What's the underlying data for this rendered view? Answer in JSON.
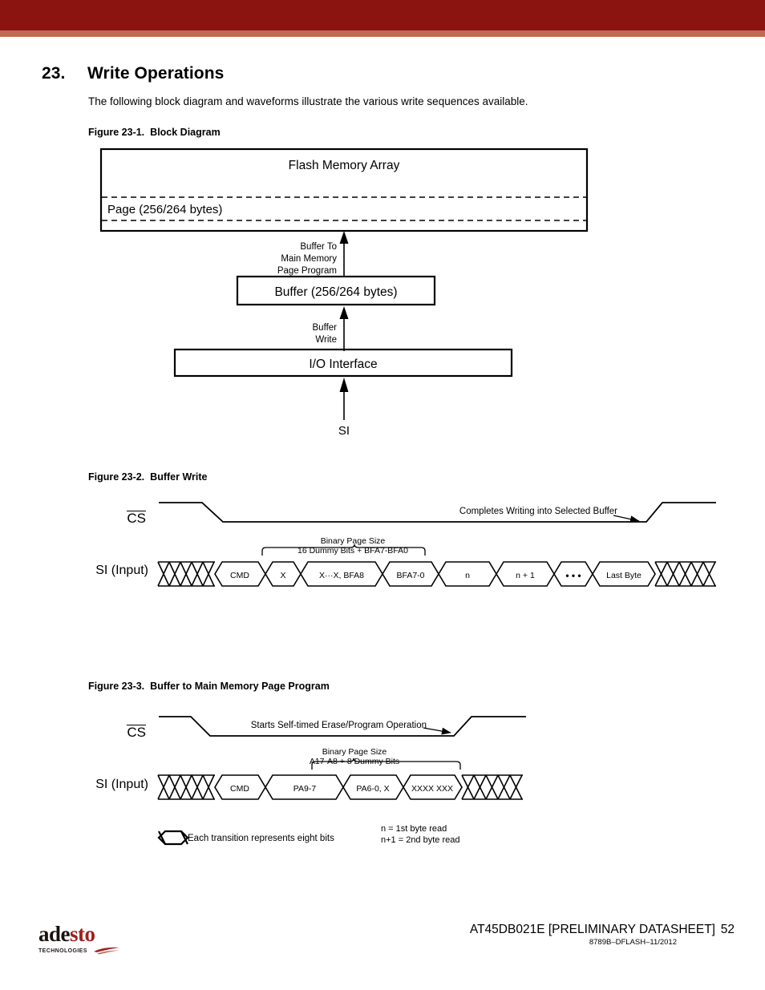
{
  "header_band": {
    "dark_color": "#8b1411",
    "light_color": "#c16a53"
  },
  "section": {
    "number": "23.",
    "title": "Write Operations",
    "intro": "The following block diagram and waveforms illustrate the various write sequences available."
  },
  "figure_1": {
    "caption_number": "Figure 23-1.",
    "caption_title": "Block Diagram",
    "flash_array_label": "Flash Memory Array",
    "page_label": "Page (256/264 bytes)",
    "arrow_top_label_line1": "Buffer To",
    "arrow_top_label_line2": "Main Memory",
    "arrow_top_label_line3": "Page Program",
    "buffer_label": "Buffer  (256/264 bytes)",
    "arrow_mid_label_line1": "Buffer",
    "arrow_mid_label_line2": "Write",
    "io_interface_label": "I/O Interface",
    "si_label": "SI"
  },
  "figure_2": {
    "caption_number": "Figure 23-2.",
    "caption_title": "Buffer Write",
    "cs_label": "CS",
    "si_label": "SI (Input)",
    "cs_annotation": "Completes Writing into Selected Buffer",
    "brace_label_line1": "Binary Page Size",
    "brace_label_line2": "16 Dummy Bits + BFA7-BFA0",
    "cells": [
      "CMD",
      "X",
      "X···X, BFA8",
      "BFA7-0",
      "n",
      "n + 1",
      "• • •",
      "Last Byte"
    ]
  },
  "figure_3": {
    "caption_number": "Figure 23-3.",
    "caption_title": "Buffer to Main Memory Page Program",
    "cs_label": "CS",
    "si_label": "SI (Input)",
    "cs_annotation": "Starts Self-timed Erase/Program Operation",
    "brace_label_line1": "Binary Page Size",
    "brace_label_line2": "A17-A8 + 8 Dummy Bits",
    "cells": [
      "CMD",
      "PA9-7",
      "PA6-0, X",
      "XXXX XXX"
    ]
  },
  "legend": {
    "transition_note": "Each transition represents eight bits",
    "n_row": "n    =  1st byte read",
    "n1_row": "n+1 =  2nd byte read"
  },
  "footer": {
    "logo_dark": "ade",
    "logo_red": "sto",
    "logo_tech": "TECHNOLOGIES",
    "document_title": "AT45DB021E [PRELIMINARY DATASHEET]",
    "page_number": "52",
    "doc_code": "8789B–DFLASH–11/2012"
  }
}
